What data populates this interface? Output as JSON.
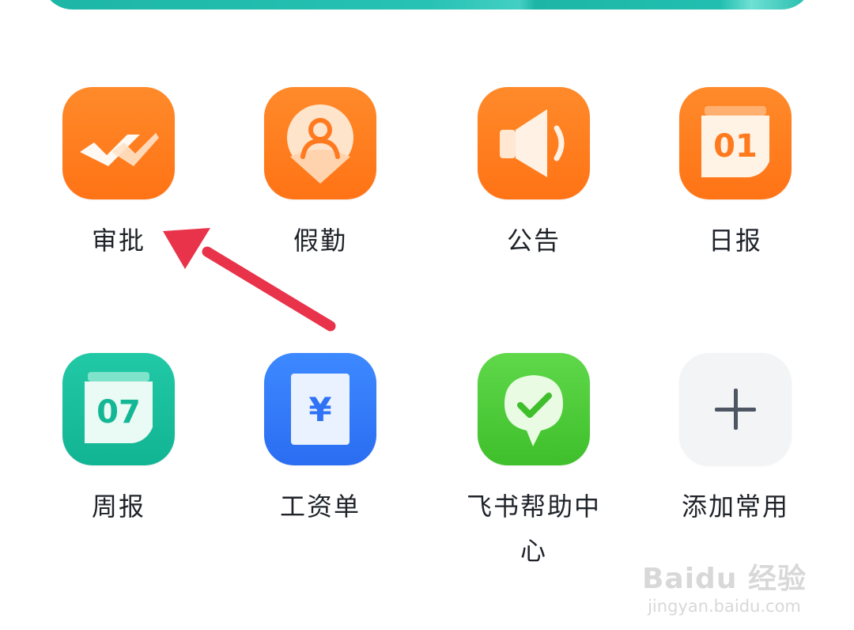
{
  "apps": [
    {
      "label": "审批",
      "icon": "approval-icon"
    },
    {
      "label": "假勤",
      "icon": "attendance-icon"
    },
    {
      "label": "公告",
      "icon": "announcement-icon"
    },
    {
      "label": "日报",
      "icon": "daily-report-icon",
      "icon_text": "01"
    },
    {
      "label": "周报",
      "icon": "weekly-report-icon",
      "icon_text": "07"
    },
    {
      "label": "工资单",
      "icon": "payslip-icon",
      "icon_text": "¥"
    },
    {
      "label": "飞书帮助中心",
      "icon": "help-center-icon"
    },
    {
      "label": "添加常用",
      "icon": "plus-icon"
    }
  ],
  "watermark": {
    "logo": "Baidu 经验",
    "url": "jingyan.baidu.com"
  },
  "colors": {
    "orange": "#ff7a1f",
    "teal": "#14b795",
    "blue": "#2f72f5",
    "green": "#48c733",
    "arrow": "#e8334a"
  }
}
